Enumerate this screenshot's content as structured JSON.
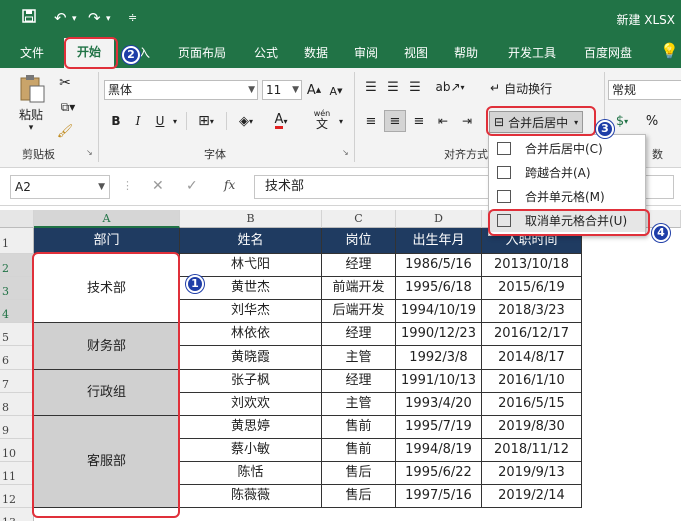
{
  "title_bar": {
    "doc_title": "新建 XLSX"
  },
  "tabs": [
    {
      "label": "文件"
    },
    {
      "label": "开始"
    },
    {
      "label": "入"
    },
    {
      "label": "页面布局"
    },
    {
      "label": "公式"
    },
    {
      "label": "数据"
    },
    {
      "label": "审阅"
    },
    {
      "label": "视图"
    },
    {
      "label": "帮助"
    },
    {
      "label": "开发工具"
    },
    {
      "label": "百度网盘"
    }
  ],
  "ribbon": {
    "clipboard": {
      "paste": "粘贴",
      "group": "剪贴板"
    },
    "font": {
      "name": "黑体",
      "size": "11",
      "group": "字体",
      "bold": "B",
      "italic": "I",
      "underline": "U",
      "grow": "A",
      "shrink": "A",
      "wen": "wén",
      "wen_char": "文"
    },
    "alignment": {
      "wrap_text": "自动换行",
      "merge_center": "合并后居中",
      "group": "对齐方式"
    },
    "number": {
      "format": "常规",
      "percent": "%",
      "group": "数"
    }
  },
  "merge_menu": {
    "items": [
      {
        "label": "合并后居中(C)"
      },
      {
        "label": "跨越合并(A)"
      },
      {
        "label": "合并单元格(M)"
      },
      {
        "label": "取消单元格合并(U)"
      }
    ]
  },
  "formula_bar": {
    "name_box": "A2",
    "fx": "fx",
    "cancel": "✕",
    "enter": "✓",
    "value": "技术部"
  },
  "columns": [
    "A",
    "B",
    "C",
    "D",
    "E"
  ],
  "rows": [
    "1",
    "2",
    "3",
    "4",
    "5",
    "6",
    "7",
    "8",
    "9",
    "10",
    "11",
    "12",
    "13"
  ],
  "sheet": {
    "headers": [
      "部门",
      "姓名",
      "岗位",
      "出生年月",
      "入职时间"
    ],
    "merged_departments": [
      {
        "label": "技术部"
      },
      {
        "label": "财务部"
      },
      {
        "label": "行政组"
      },
      {
        "label": "客服部"
      }
    ],
    "records": [
      [
        "林弋阳",
        "经理",
        "1986/5/16",
        "2013/10/18"
      ],
      [
        "黄世杰",
        "前端开发",
        "1995/6/18",
        "2015/6/19"
      ],
      [
        "刘华杰",
        "后端开发",
        "1994/10/19",
        "2018/3/23"
      ],
      [
        "林依依",
        "经理",
        "1990/12/23",
        "2016/12/17"
      ],
      [
        "黄晓霞",
        "主管",
        "1992/3/8",
        "2014/8/17"
      ],
      [
        "张子枫",
        "经理",
        "1991/10/13",
        "2016/1/10"
      ],
      [
        "刘欢欢",
        "主管",
        "1993/4/20",
        "2016/5/15"
      ],
      [
        "黄思婷",
        "售前",
        "1995/7/19",
        "2019/8/30"
      ],
      [
        "蔡小敏",
        "售前",
        "1994/8/19",
        "2018/11/12"
      ],
      [
        "陈恬",
        "售后",
        "1995/6/22",
        "2019/9/13"
      ],
      [
        "陈薇薇",
        "售后",
        "1997/5/16",
        "2019/2/14"
      ]
    ]
  },
  "badges": [
    "1",
    "2",
    "3",
    "4"
  ],
  "colors": {
    "excel_green": "#217346",
    "header_navy": "#1f3b61",
    "annotation_red": "#e0303a",
    "badge_blue": "#1f3ea8"
  }
}
